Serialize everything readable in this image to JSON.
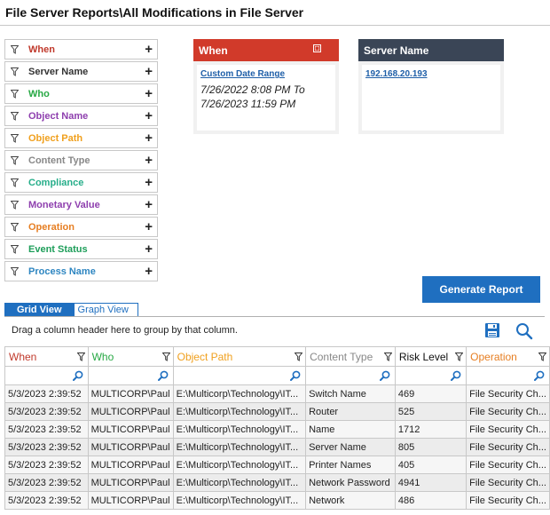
{
  "page": {
    "title": "File Server Reports\\All Modifications in File Server"
  },
  "filters": [
    {
      "label": "When",
      "color": "#c0392b"
    },
    {
      "label": "Server Name",
      "color": "#333333"
    },
    {
      "label": "Who",
      "color": "#27a844"
    },
    {
      "label": "Object Name",
      "color": "#8e3fae"
    },
    {
      "label": "Object Path",
      "color": "#f0a01e"
    },
    {
      "label": "Content Type",
      "color": "#888888"
    },
    {
      "label": "Compliance",
      "color": "#27ae8a"
    },
    {
      "label": "Monetary Value",
      "color": "#8e3fae"
    },
    {
      "label": "Operation",
      "color": "#e67e22"
    },
    {
      "label": "Event Status",
      "color": "#1e9e5a"
    },
    {
      "label": "Process Name",
      "color": "#2e86c1"
    }
  ],
  "filter_plus": "+",
  "when_card": {
    "title": "When",
    "header_color": "#d13a2a",
    "link": "Custom Date Range",
    "range_line1": "7/26/2022 8:08 PM To",
    "range_line2": "7/26/2023 11:59 PM"
  },
  "server_card": {
    "title": "Server Name",
    "header_color": "#3a4556",
    "link": "192.168.20.193"
  },
  "generate_button": "Generate Report",
  "tabs": {
    "grid": "Grid View",
    "graph": "Graph View"
  },
  "group_hint": "Drag a column header here to group by that column.",
  "icons": {
    "save": "save-icon",
    "search": "search-icon",
    "filter": "funnel-icon"
  },
  "grid": {
    "columns": [
      {
        "label": "When",
        "color": "#c0392b",
        "bold": false
      },
      {
        "label": "Who",
        "color": "#27a844",
        "bold": false
      },
      {
        "label": "Object Path",
        "color": "#f0a01e",
        "bold": false
      },
      {
        "label": "Content Type",
        "color": "#888888",
        "bold": false
      },
      {
        "label": "Risk Level",
        "color": "#111111",
        "bold": false
      },
      {
        "label": "Operation",
        "color": "#e67e22",
        "bold": false
      }
    ],
    "rows": [
      [
        "5/3/2023 2:39:52",
        "MULTICORP\\Paul",
        "E:\\Multicorp\\Technology\\IT...",
        "Switch Name",
        "469",
        "File Security Ch..."
      ],
      [
        "5/3/2023 2:39:52",
        "MULTICORP\\Paul",
        "E:\\Multicorp\\Technology\\IT...",
        "Router",
        "525",
        "File Security Ch..."
      ],
      [
        "5/3/2023 2:39:52",
        "MULTICORP\\Paul",
        "E:\\Multicorp\\Technology\\IT...",
        "Name",
        "1712",
        "File Security Ch..."
      ],
      [
        "5/3/2023 2:39:52",
        "MULTICORP\\Paul",
        "E:\\Multicorp\\Technology\\IT...",
        "Server Name",
        "805",
        "File Security Ch..."
      ],
      [
        "5/3/2023 2:39:52",
        "MULTICORP\\Paul",
        "E:\\Multicorp\\Technology\\IT...",
        "Printer Names",
        "405",
        "File Security Ch..."
      ],
      [
        "5/3/2023 2:39:52",
        "MULTICORP\\Paul",
        "E:\\Multicorp\\Technology\\IT...",
        "Network Password",
        "4941",
        "File Security Ch..."
      ],
      [
        "5/3/2023 2:39:52",
        "MULTICORP\\Paul",
        "E:\\Multicorp\\Technology\\IT...",
        "Network",
        "486",
        "File Security Ch..."
      ]
    ]
  }
}
